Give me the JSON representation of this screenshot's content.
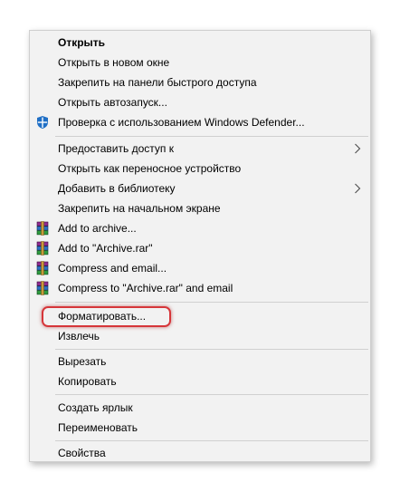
{
  "context_menu": {
    "items": [
      {
        "label": "Открыть"
      },
      {
        "label": "Открыть в новом окне"
      },
      {
        "label": "Закрепить на панели быстрого доступа"
      },
      {
        "label": "Открыть автозапуск..."
      },
      {
        "label": "Проверка с использованием Windows Defender...",
        "icon": "windows-defender-icon"
      },
      {
        "label": "Предоставить доступ к",
        "submenu": true
      },
      {
        "label": "Открыть как переносное устройство"
      },
      {
        "label": "Добавить в библиотеку",
        "submenu": true
      },
      {
        "label": "Закрепить на начальном экране"
      },
      {
        "label": "Add to archive...",
        "icon": "winrar-icon"
      },
      {
        "label": "Add to \"Archive.rar\"",
        "icon": "winrar-icon"
      },
      {
        "label": "Compress and email...",
        "icon": "winrar-icon"
      },
      {
        "label": "Compress to \"Archive.rar\" and email",
        "icon": "winrar-icon"
      },
      {
        "label": "Форматировать...",
        "highlighted": true
      },
      {
        "label": "Извлечь"
      },
      {
        "label": "Вырезать"
      },
      {
        "label": "Копировать"
      },
      {
        "label": "Создать ярлык"
      },
      {
        "label": "Переименовать"
      },
      {
        "label": "Свойства"
      }
    ]
  },
  "colors": {
    "menu_background": "#f2f2f2",
    "separator": "#d0d0d0",
    "highlight_outline": "#d6363a",
    "defender_blue": "#1f6fc5"
  }
}
